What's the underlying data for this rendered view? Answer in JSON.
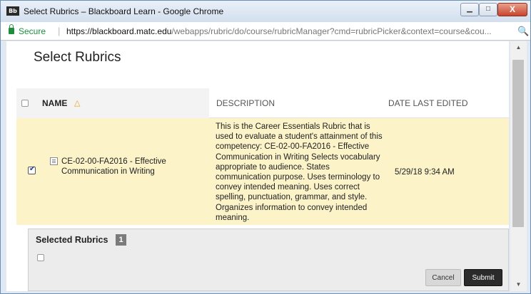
{
  "window": {
    "app_badge": "Bb",
    "title": "Select Rubrics – Blackboard Learn - Google Chrome",
    "minimize_glyph": "▁",
    "maximize_glyph": "□",
    "close_glyph": "X"
  },
  "address": {
    "secure_label": "Secure",
    "separator": "|",
    "url_host": "https://blackboard.matc.edu",
    "url_path": "/webapps/rubric/do/course/rubricManager?cmd=rubricPicker&context=course&cou...",
    "zoom_glyph": "🔍"
  },
  "page": {
    "title": "Select Rubrics"
  },
  "table": {
    "columns": {
      "name": "NAME",
      "description": "DESCRIPTION",
      "date": "DATE LAST EDITED"
    },
    "sort_glyph": "△",
    "rows": [
      {
        "checked": true,
        "check_glyph": "✔",
        "name": "CE-02-00-FA2016 - Effective Communication in Writing",
        "description": "This is the Career Essentials Rubric that is used to evaluate a student's attainment of this competency: CE-02-00-FA2016 - Effective Communication in Writing Selects vocabulary appropriate to audience.  States communication purpose. Uses terminology to convey intended meaning.  Uses correct spelling, punctuation, grammar, and style. Organizes information to convey intended meaning.",
        "date": "5/29/18 9:34 AM"
      }
    ]
  },
  "selected": {
    "title": "Selected Rubrics",
    "count": "1"
  },
  "buttons": {
    "cancel": "Cancel",
    "submit": "Submit"
  },
  "scrollbar": {
    "up_glyph": "▲",
    "down_glyph": "▼"
  },
  "colors": {
    "selected_row": "#fcf3c9",
    "secure_green": "#1e8e3e",
    "sort_arrow": "#e3a21a",
    "submit_bg": "#2b2b2b"
  }
}
